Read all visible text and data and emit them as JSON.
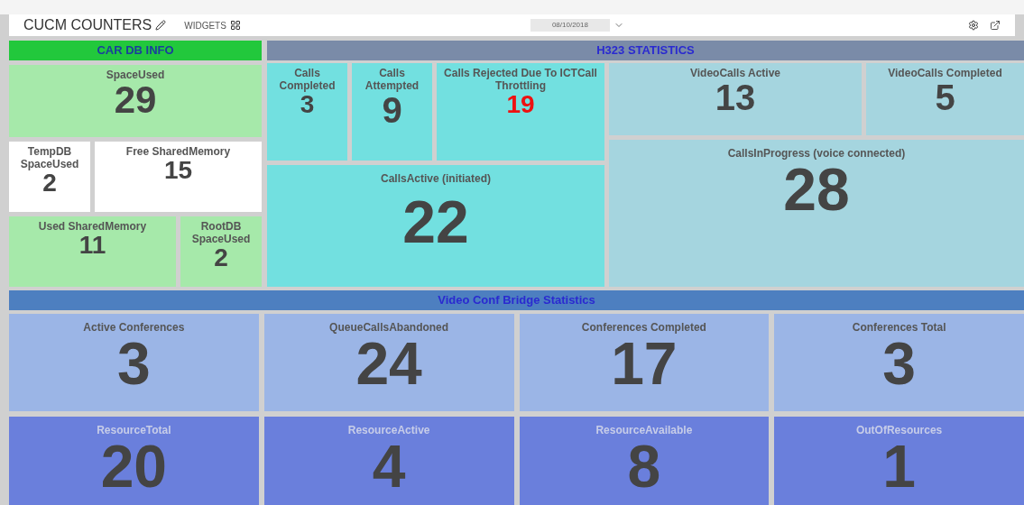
{
  "toolbar": {
    "title": "CUCM COUNTERS",
    "widgets_label": "WIDGETS",
    "date": "08/10/2018"
  },
  "car_db": {
    "title": "CAR DB INFO",
    "tiles": [
      {
        "label": "SpaceUsed",
        "value": "29",
        "color": "#a6e9aa",
        "alert": false
      },
      {
        "label": "TempDB SpaceUsed",
        "value": "2",
        "color": "#ffffff",
        "alert": false
      },
      {
        "label": "Free SharedMemory",
        "value": "15",
        "color": "#ffffff",
        "alert": false
      },
      {
        "label": "Used SharedMemory",
        "value": "11",
        "color": "#a6e9aa",
        "alert": false
      },
      {
        "label": "RootDB SpaceUsed",
        "value": "2",
        "color": "#a6e9aa",
        "alert": false
      }
    ]
  },
  "h323": {
    "title": "H323 STATISTICS",
    "tiles": [
      {
        "label": "Calls Completed",
        "value": "3",
        "color": "#72e0e0",
        "alert": false
      },
      {
        "label": "Calls Attempted",
        "value": "9",
        "color": "#72e0e0",
        "alert": false
      },
      {
        "label": "Calls Rejected Due To ICTCall Throttling",
        "value": "19",
        "color": "#72e0e0",
        "alert": true
      },
      {
        "label": "CallsActive (initiated)",
        "value": "22",
        "color": "#72e0e0",
        "alert": false
      },
      {
        "label": "VideoCalls Active",
        "value": "13",
        "color": "#a5d5df",
        "alert": false
      },
      {
        "label": "VideoCalls Completed",
        "value": "5",
        "color": "#a5d5df",
        "alert": false
      },
      {
        "label": "CallsInProgress (voice connected)",
        "value": "28",
        "color": "#a5d5df",
        "alert": false
      }
    ]
  },
  "video_conf": {
    "title": "Video Conf Bridge Statistics",
    "tiles": [
      {
        "label": "Active Conferences",
        "value": "3",
        "color": "#9bb5e6",
        "alert": false
      },
      {
        "label": "QueueCallsAbandoned",
        "value": "24",
        "color": "#9bb5e6",
        "alert": false
      },
      {
        "label": "Conferences Completed",
        "value": "17",
        "color": "#9bb5e6",
        "alert": false
      },
      {
        "label": "Conferences Total",
        "value": "3",
        "color": "#9bb5e6",
        "alert": false
      },
      {
        "label": "ResourceTotal",
        "value": "20",
        "color": "#6a7fdc",
        "alert": false
      },
      {
        "label": "ResourceActive",
        "value": "4",
        "color": "#6a7fdc",
        "alert": false
      },
      {
        "label": "ResourceAvailable",
        "value": "8",
        "color": "#6a7fdc",
        "alert": false
      },
      {
        "label": "OutOfResources",
        "value": "1",
        "color": "#6a7fdc",
        "alert": false
      }
    ]
  }
}
